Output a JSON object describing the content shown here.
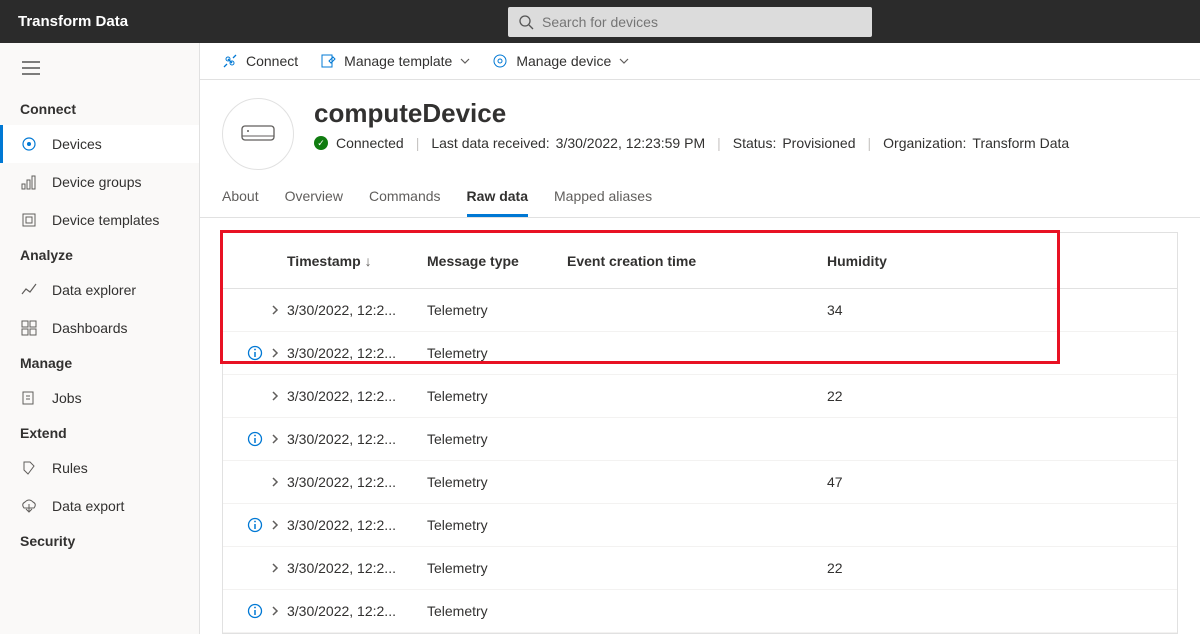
{
  "app_title": "Transform Data",
  "search_placeholder": "Search for devices",
  "sidebar": {
    "sections": [
      {
        "heading": "Connect",
        "items": [
          {
            "icon": "devices-icon",
            "label": "Devices",
            "active": true
          },
          {
            "icon": "device-groups-icon",
            "label": "Device groups"
          },
          {
            "icon": "device-templates-icon",
            "label": "Device templates"
          }
        ]
      },
      {
        "heading": "Analyze",
        "items": [
          {
            "icon": "data-explorer-icon",
            "label": "Data explorer"
          },
          {
            "icon": "dashboards-icon",
            "label": "Dashboards"
          }
        ]
      },
      {
        "heading": "Manage",
        "items": [
          {
            "icon": "jobs-icon",
            "label": "Jobs"
          }
        ]
      },
      {
        "heading": "Extend",
        "items": [
          {
            "icon": "rules-icon",
            "label": "Rules"
          },
          {
            "icon": "data-export-icon",
            "label": "Data export"
          }
        ]
      },
      {
        "heading": "Security",
        "items": []
      }
    ]
  },
  "toolbar": {
    "connect": "Connect",
    "manage_template": "Manage template",
    "manage_device": "Manage device"
  },
  "device": {
    "name": "computeDevice",
    "connected": "Connected",
    "last_data_label": "Last data received:",
    "last_data_value": "3/30/2022, 12:23:59 PM",
    "status_label": "Status:",
    "status_value": "Provisioned",
    "org_label": "Organization:",
    "org_value": "Transform Data"
  },
  "tabs": [
    "About",
    "Overview",
    "Commands",
    "Raw data",
    "Mapped aliases"
  ],
  "active_tab": "Raw data",
  "table": {
    "headers": {
      "timestamp": "Timestamp",
      "message_type": "Message type",
      "event_time": "Event creation time",
      "humidity": "Humidity"
    },
    "rows": [
      {
        "info": false,
        "timestamp": "3/30/2022, 12:2...",
        "message_type": "Telemetry",
        "event_time": "",
        "humidity": "34"
      },
      {
        "info": true,
        "timestamp": "3/30/2022, 12:2...",
        "message_type": "Telemetry",
        "event_time": "",
        "humidity": ""
      },
      {
        "info": false,
        "timestamp": "3/30/2022, 12:2...",
        "message_type": "Telemetry",
        "event_time": "",
        "humidity": "22"
      },
      {
        "info": true,
        "timestamp": "3/30/2022, 12:2...",
        "message_type": "Telemetry",
        "event_time": "",
        "humidity": ""
      },
      {
        "info": false,
        "timestamp": "3/30/2022, 12:2...",
        "message_type": "Telemetry",
        "event_time": "",
        "humidity": "47"
      },
      {
        "info": true,
        "timestamp": "3/30/2022, 12:2...",
        "message_type": "Telemetry",
        "event_time": "",
        "humidity": ""
      },
      {
        "info": false,
        "timestamp": "3/30/2022, 12:2...",
        "message_type": "Telemetry",
        "event_time": "",
        "humidity": "22"
      },
      {
        "info": true,
        "timestamp": "3/30/2022, 12:2...",
        "message_type": "Telemetry",
        "event_time": "",
        "humidity": ""
      }
    ]
  }
}
